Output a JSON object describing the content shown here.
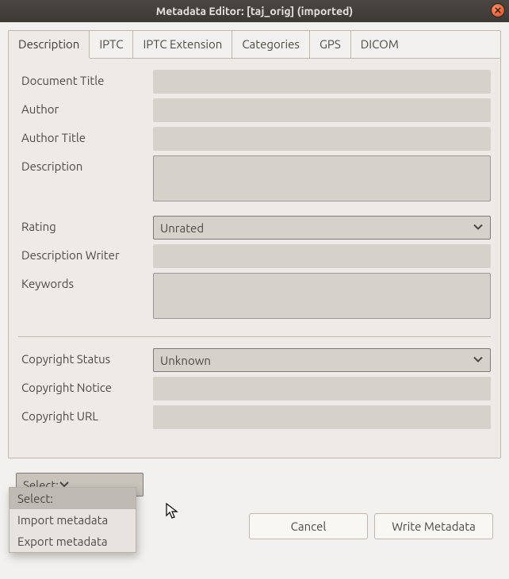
{
  "titlebar": {
    "title": "Metadata Editor: [taj_orig] (imported)"
  },
  "tabs": {
    "description": "Description",
    "iptc": "IPTC",
    "iptc_ext": "IPTC Extension",
    "categories": "Categories",
    "gps": "GPS",
    "dicom": "DICOM"
  },
  "fields": {
    "document_title": {
      "label": "Document Title",
      "value": ""
    },
    "author": {
      "label": "Author",
      "value": ""
    },
    "author_title": {
      "label": "Author Title",
      "value": ""
    },
    "description": {
      "label": "Description",
      "value": ""
    },
    "rating": {
      "label": "Rating",
      "value": "Unrated"
    },
    "description_writer": {
      "label": "Description Writer",
      "value": ""
    },
    "keywords": {
      "label": "Keywords",
      "value": ""
    },
    "copyright_status": {
      "label": "Copyright Status",
      "value": "Unknown"
    },
    "copyright_notice": {
      "label": "Copyright Notice",
      "value": ""
    },
    "copyright_url": {
      "label": "Copyright URL",
      "value": ""
    }
  },
  "action_select": {
    "label": "Select:",
    "options": {
      "select": "Select:",
      "import": "Import metadata",
      "export": "Export metadata"
    }
  },
  "buttons": {
    "cancel": "Cancel",
    "write": "Write Metadata"
  }
}
